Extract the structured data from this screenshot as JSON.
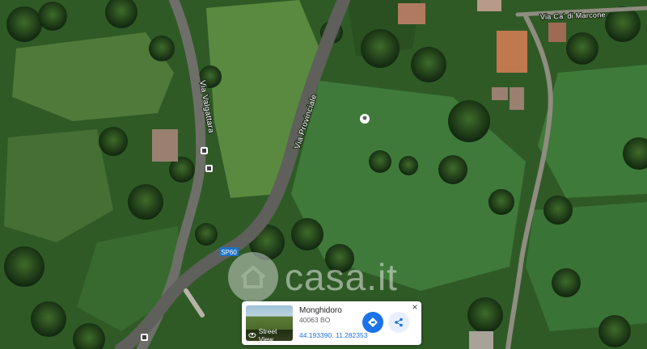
{
  "map": {
    "roads": [
      {
        "name": "Via Valgattara"
      },
      {
        "name": "Via Provinciale"
      },
      {
        "name": "Via Ca' di Marcone"
      },
      {
        "name": "SP60"
      }
    ]
  },
  "watermark": {
    "brand": "casa.it"
  },
  "place_card": {
    "title": "Monghidoro",
    "subtitle": "40063 BO",
    "coordinates": "44.193390, 11.282353",
    "street_view_label": "Street View",
    "close_glyph": "×"
  },
  "colors": {
    "directions_button": "#1a73e8",
    "share_button": "#e8f0fe",
    "coords_link": "#1a73e8"
  }
}
